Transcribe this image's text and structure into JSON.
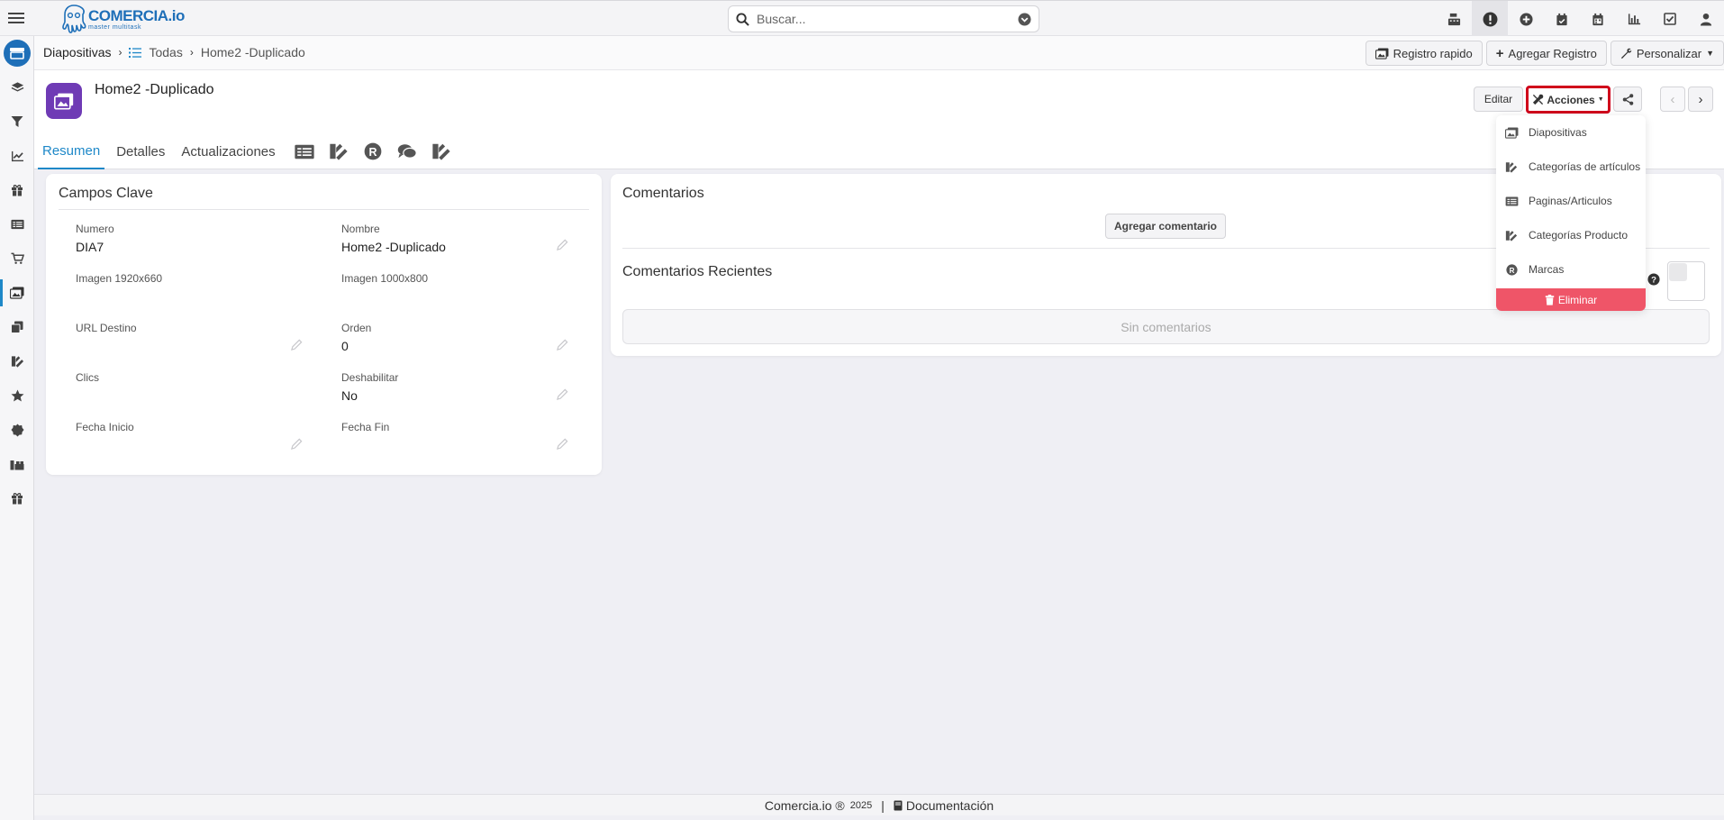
{
  "app": {
    "brand_name": "COMERCIA.io",
    "brand_tagline": "master multitask"
  },
  "search": {
    "placeholder": "Buscar..."
  },
  "breadcrumb": {
    "module": "Diapositivas",
    "list": "Todas",
    "record": "Home2 -Duplicado"
  },
  "toolbar": {
    "quick_register": "Registro rapido",
    "add_record": "Agregar Registro",
    "customize": "Personalizar"
  },
  "record": {
    "title": "Home2 -Duplicado",
    "edit_label": "Editar",
    "actions_label": "Acciones"
  },
  "tabs": [
    {
      "label": "Resumen"
    },
    {
      "label": "Detalles"
    },
    {
      "label": "Actualizaciones"
    }
  ],
  "actions_menu": {
    "items": [
      {
        "label": "Diapositivas",
        "icon": "slides-icon"
      },
      {
        "label": "Categorías de artículos",
        "icon": "category-icon"
      },
      {
        "label": "Paginas/Articulos",
        "icon": "list-icon"
      },
      {
        "label": "Categorías Producto",
        "icon": "category-icon"
      },
      {
        "label": "Marcas",
        "icon": "registered-icon"
      }
    ],
    "delete_label": "Eliminar"
  },
  "key_fields": {
    "title": "Campos Clave",
    "fields": [
      {
        "label": "Numero",
        "value": "DIA7"
      },
      {
        "label": "Nombre",
        "value": "Home2 -Duplicado"
      },
      {
        "label": "Imagen 1920x660",
        "value": ""
      },
      {
        "label": "Imagen 1000x800",
        "value": ""
      },
      {
        "label": "URL Destino",
        "value": ""
      },
      {
        "label": "Orden",
        "value": "0"
      },
      {
        "label": "Clics",
        "value": ""
      },
      {
        "label": "Deshabilitar",
        "value": "No"
      },
      {
        "label": "Fecha Inicio",
        "value": ""
      },
      {
        "label": "Fecha Fin",
        "value": ""
      }
    ]
  },
  "comments": {
    "title": "Comentarios",
    "add_label": "Agregar comentario",
    "recent_title": "Comentarios Recientes",
    "empty_text": "Sin comentarios"
  },
  "footer": {
    "brand": "Comercia.io ®",
    "year": "2025",
    "separator": "|",
    "docs": "Documentación"
  },
  "colors": {
    "accent": "#1e88c8",
    "brand": "#1e6fb8",
    "record_icon": "#6f3bb5",
    "danger": "#ef5568",
    "highlight_border": "#d0021b"
  }
}
